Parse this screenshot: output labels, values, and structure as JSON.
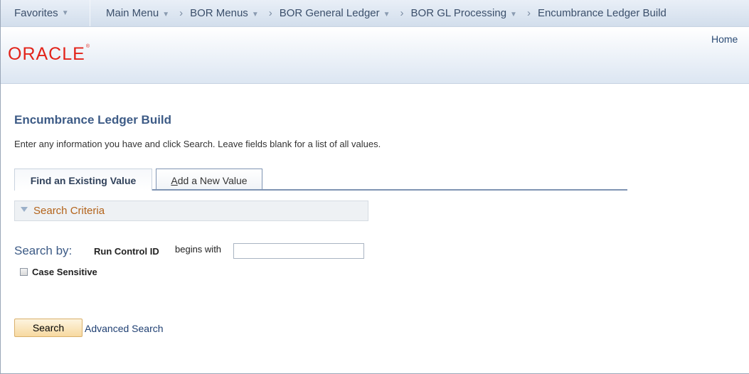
{
  "nav": {
    "favorites": "Favorites",
    "main_menu": "Main Menu",
    "crumbs": [
      "BOR Menus",
      "BOR General Ledger",
      "BOR GL Processing",
      "Encumbrance Ledger Build"
    ]
  },
  "header": {
    "logo_text": "ORACLE",
    "home_link": "Home"
  },
  "page": {
    "title": "Encumbrance Ledger Build",
    "instructions": "Enter any information you have and click Search. Leave fields blank for a list of all values."
  },
  "tabs": {
    "find_label": "Find an Existing Value",
    "add_label_first": "A",
    "add_label_rest": "dd a New Value"
  },
  "criteria": {
    "label": "Search Criteria"
  },
  "search": {
    "search_by": "Search by:",
    "field_label": "Run Control ID",
    "operator": "begins with",
    "value": "",
    "case_sensitive_label": "Case Sensitive",
    "case_sensitive_checked": false
  },
  "buttons": {
    "search_label": "Search",
    "advanced_label": "Advanced Search"
  },
  "colors": {
    "title_blue": "#3d5b86",
    "oracle_red": "#e2231a",
    "criteria_orange": "#b3631a",
    "search_button": "#f7d9a0"
  }
}
